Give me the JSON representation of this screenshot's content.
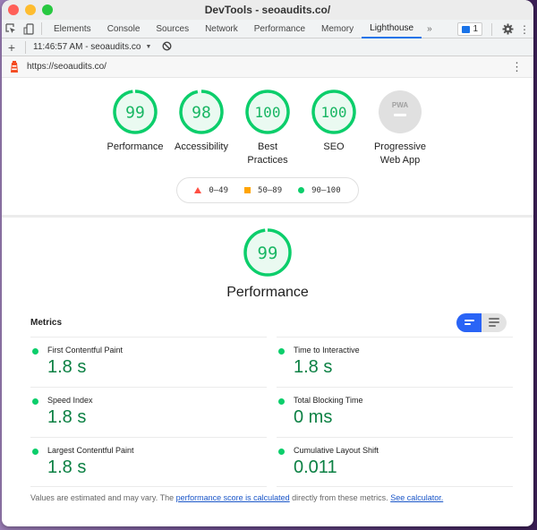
{
  "window": {
    "title": "DevTools - seoaudits.co/"
  },
  "tabbar": {
    "tabs": [
      {
        "label": "Elements",
        "active": false
      },
      {
        "label": "Console",
        "active": false
      },
      {
        "label": "Sources",
        "active": false
      },
      {
        "label": "Network",
        "active": false
      },
      {
        "label": "Performance",
        "active": false
      },
      {
        "label": "Memory",
        "active": false
      },
      {
        "label": "Lighthouse",
        "active": true
      }
    ],
    "more_label": "»",
    "issues_count": "1"
  },
  "toolbar": {
    "add_label": "+",
    "report_select": "11:46:57 AM - seoaudits.co",
    "dropdown_glyph": "▼",
    "clear_glyph": "⃠"
  },
  "urlbar": {
    "url": "https://seoaudits.co/",
    "menu_glyph": "⋮"
  },
  "gauges": [
    {
      "label": "Performance",
      "score": "99",
      "value": 99
    },
    {
      "label": "Accessibility",
      "score": "98",
      "value": 98
    },
    {
      "label": "Best Practices",
      "score": "100",
      "value": 100
    },
    {
      "label": "SEO",
      "score": "100",
      "value": 100
    },
    {
      "label": "Progressive Web App",
      "score": "PWA",
      "value": null
    }
  ],
  "legend": {
    "fail": "0–49",
    "average": "50–89",
    "pass": "90–100"
  },
  "performance": {
    "score": "99",
    "value": 99,
    "title": "Performance"
  },
  "metrics": {
    "title": "Metrics",
    "items": [
      {
        "name": "First Contentful Paint",
        "value": "1.8 s"
      },
      {
        "name": "Time to Interactive",
        "value": "1.8 s"
      },
      {
        "name": "Speed Index",
        "value": "1.8 s"
      },
      {
        "name": "Total Blocking Time",
        "value": "0 ms"
      },
      {
        "name": "Largest Contentful Paint",
        "value": "1.8 s"
      },
      {
        "name": "Cumulative Layout Shift",
        "value": "0.011"
      }
    ]
  },
  "footnote": {
    "prefix": "Values are estimated and may vary. The ",
    "link1": "performance score is calculated",
    "middle": " directly from these metrics. ",
    "link2": "See calculator."
  },
  "colors": {
    "pass": "#0cce6b",
    "pass_text": "#0b8043",
    "average": "#ffa400",
    "fail": "#ff4e42",
    "accent": "#1a73e8"
  }
}
